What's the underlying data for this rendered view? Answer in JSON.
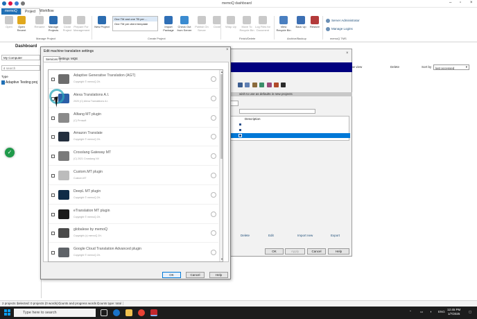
{
  "window": {
    "title": "memoQ dashboard"
  },
  "ribbon_tabs": [
    "memoQ",
    "Project",
    "Workflow"
  ],
  "ribbon": {
    "buttons": [
      {
        "label": "Open",
        "icon": "folder-open-icon",
        "enabled": false
      },
      {
        "label": "Open Recent",
        "icon": "recent-folder-icon",
        "enabled": true
      },
      {
        "label": "Rename",
        "icon": "rename-icon",
        "enabled": false
      },
      {
        "label": "Manage Projects",
        "icon": "manage-projects-icon",
        "enabled": true
      },
      {
        "label": "Clone Project",
        "icon": "clone-project-icon",
        "enabled": false
      },
      {
        "label": "Prepare For Management",
        "icon": "prepare-management-icon",
        "enabled": false
      },
      {
        "label": "New Project",
        "icon": "new-project-icon",
        "enabled": true
      },
      {
        "label": "Import Package",
        "icon": "import-package-icon",
        "enabled": true
      },
      {
        "label": "Check Out from Server",
        "icon": "checkout-server-icon",
        "enabled": true
      },
      {
        "label": "Publish On Server",
        "icon": "publish-server-icon",
        "enabled": false
      },
      {
        "label": "Clone",
        "icon": "clone-icon",
        "enabled": false
      },
      {
        "label": "Wrap Up",
        "icon": "wrap-up-icon",
        "enabled": false
      },
      {
        "label": "Move To Recycle Bin",
        "icon": "move-recycle-icon",
        "enabled": false
      },
      {
        "label": "Log Files for Document",
        "icon": "log-files-icon",
        "enabled": false
      },
      {
        "label": "View Recycle Bin",
        "icon": "recycle-bin-icon",
        "enabled": true
      },
      {
        "label": "Back Up",
        "icon": "backup-icon",
        "enabled": true
      },
      {
        "label": "Restore",
        "icon": "restore-icon",
        "enabled": true
      }
    ],
    "template_list": [
      "One TM and one TB per ...",
      "One TM per client template"
    ],
    "groups": [
      "Manage Project",
      "Create Project",
      "Finish/Delete",
      "Archive/Backup",
      "memoQ TMS"
    ],
    "server_links": [
      "Server Administrator",
      "Manage Logins"
    ]
  },
  "dashboard": {
    "label": "Dashboard",
    "computer": "My Computer",
    "search_placeholder": "search",
    "type_label": "Type",
    "project_name": "Adaptive Testing proj",
    "toolbar": {
      "two_row_view": "Two-row view",
      "delete": "Delete",
      "sort_by": "Sort by",
      "sort_value": "last accessed"
    }
  },
  "background_dialog": {
    "hint": "wish to use as defaults in new projects",
    "column_description": "Description",
    "links": [
      "Delete",
      "Edit",
      "Import new",
      "Export"
    ],
    "buttons": {
      "ok": "OK",
      "apply": "Apply",
      "cancel": "Cancel",
      "help": "Help"
    }
  },
  "mt_dialog": {
    "title": "Edit machine translation settings",
    "tabs": [
      "Services",
      "Settings",
      "MQE"
    ],
    "active_tab": "Services",
    "services": [
      {
        "name": "Adaptive Generative Translation (AGT)",
        "copyright": "Copyright © memoQ Zrt.",
        "logo_color": "#6d6d6d"
      },
      {
        "name": "Alexa Translations A.I.",
        "copyright": "2020 (C) Alexa Translations A.I.",
        "logo_color": "#2b5ea7"
      },
      {
        "name": "Alltang MT plugin",
        "copyright": "(C) Prmsoft",
        "logo_color": "#8a8a8a"
      },
      {
        "name": "Amazon Translate",
        "copyright": "Copyright © memoQ Zrt.",
        "logo_color": "#232f3e"
      },
      {
        "name": "Crosslang Gateway MT",
        "copyright": "(C) 2021 Crosslang NV",
        "logo_color": "#7a7a7a"
      },
      {
        "name": "Custom.MT plugin",
        "copyright": "Custom.MT",
        "logo_color": "#bcbcbc"
      },
      {
        "name": "DeepL MT plugin",
        "copyright": "Copyright © memoQ Zrt.",
        "logo_color": "#0f2b46"
      },
      {
        "name": "eTranslation MT plugin",
        "copyright": "Copyright © memoQ Zrt.",
        "logo_color": "#1b1b1b"
      },
      {
        "name": "globalese by memoQ",
        "copyright": "Copyright (c) memoQ Zrt.",
        "logo_color": "#4a4a4a"
      },
      {
        "name": "Google Cloud Translation Advanced plugin",
        "copyright": "Copyright © memoQ Zrt.",
        "logo_color": "#5f6368"
      }
    ],
    "buttons": {
      "ok": "OK",
      "cancel": "Cancel",
      "help": "Help"
    }
  },
  "status_bar": [
    "2 projects",
    "Selected: 0 projects (0 words)",
    "Counts and progress words",
    "Counts type: total"
  ],
  "taskbar": {
    "search_placeholder": "Type here to search",
    "language": "ENG",
    "time": "12:45 PM",
    "date": "1/7/2025"
  },
  "colors": {
    "accent": "#1f6fb5",
    "dark_blue_bar": "#00007f",
    "selection": "#0078d7",
    "success": "#1f9a4a"
  }
}
